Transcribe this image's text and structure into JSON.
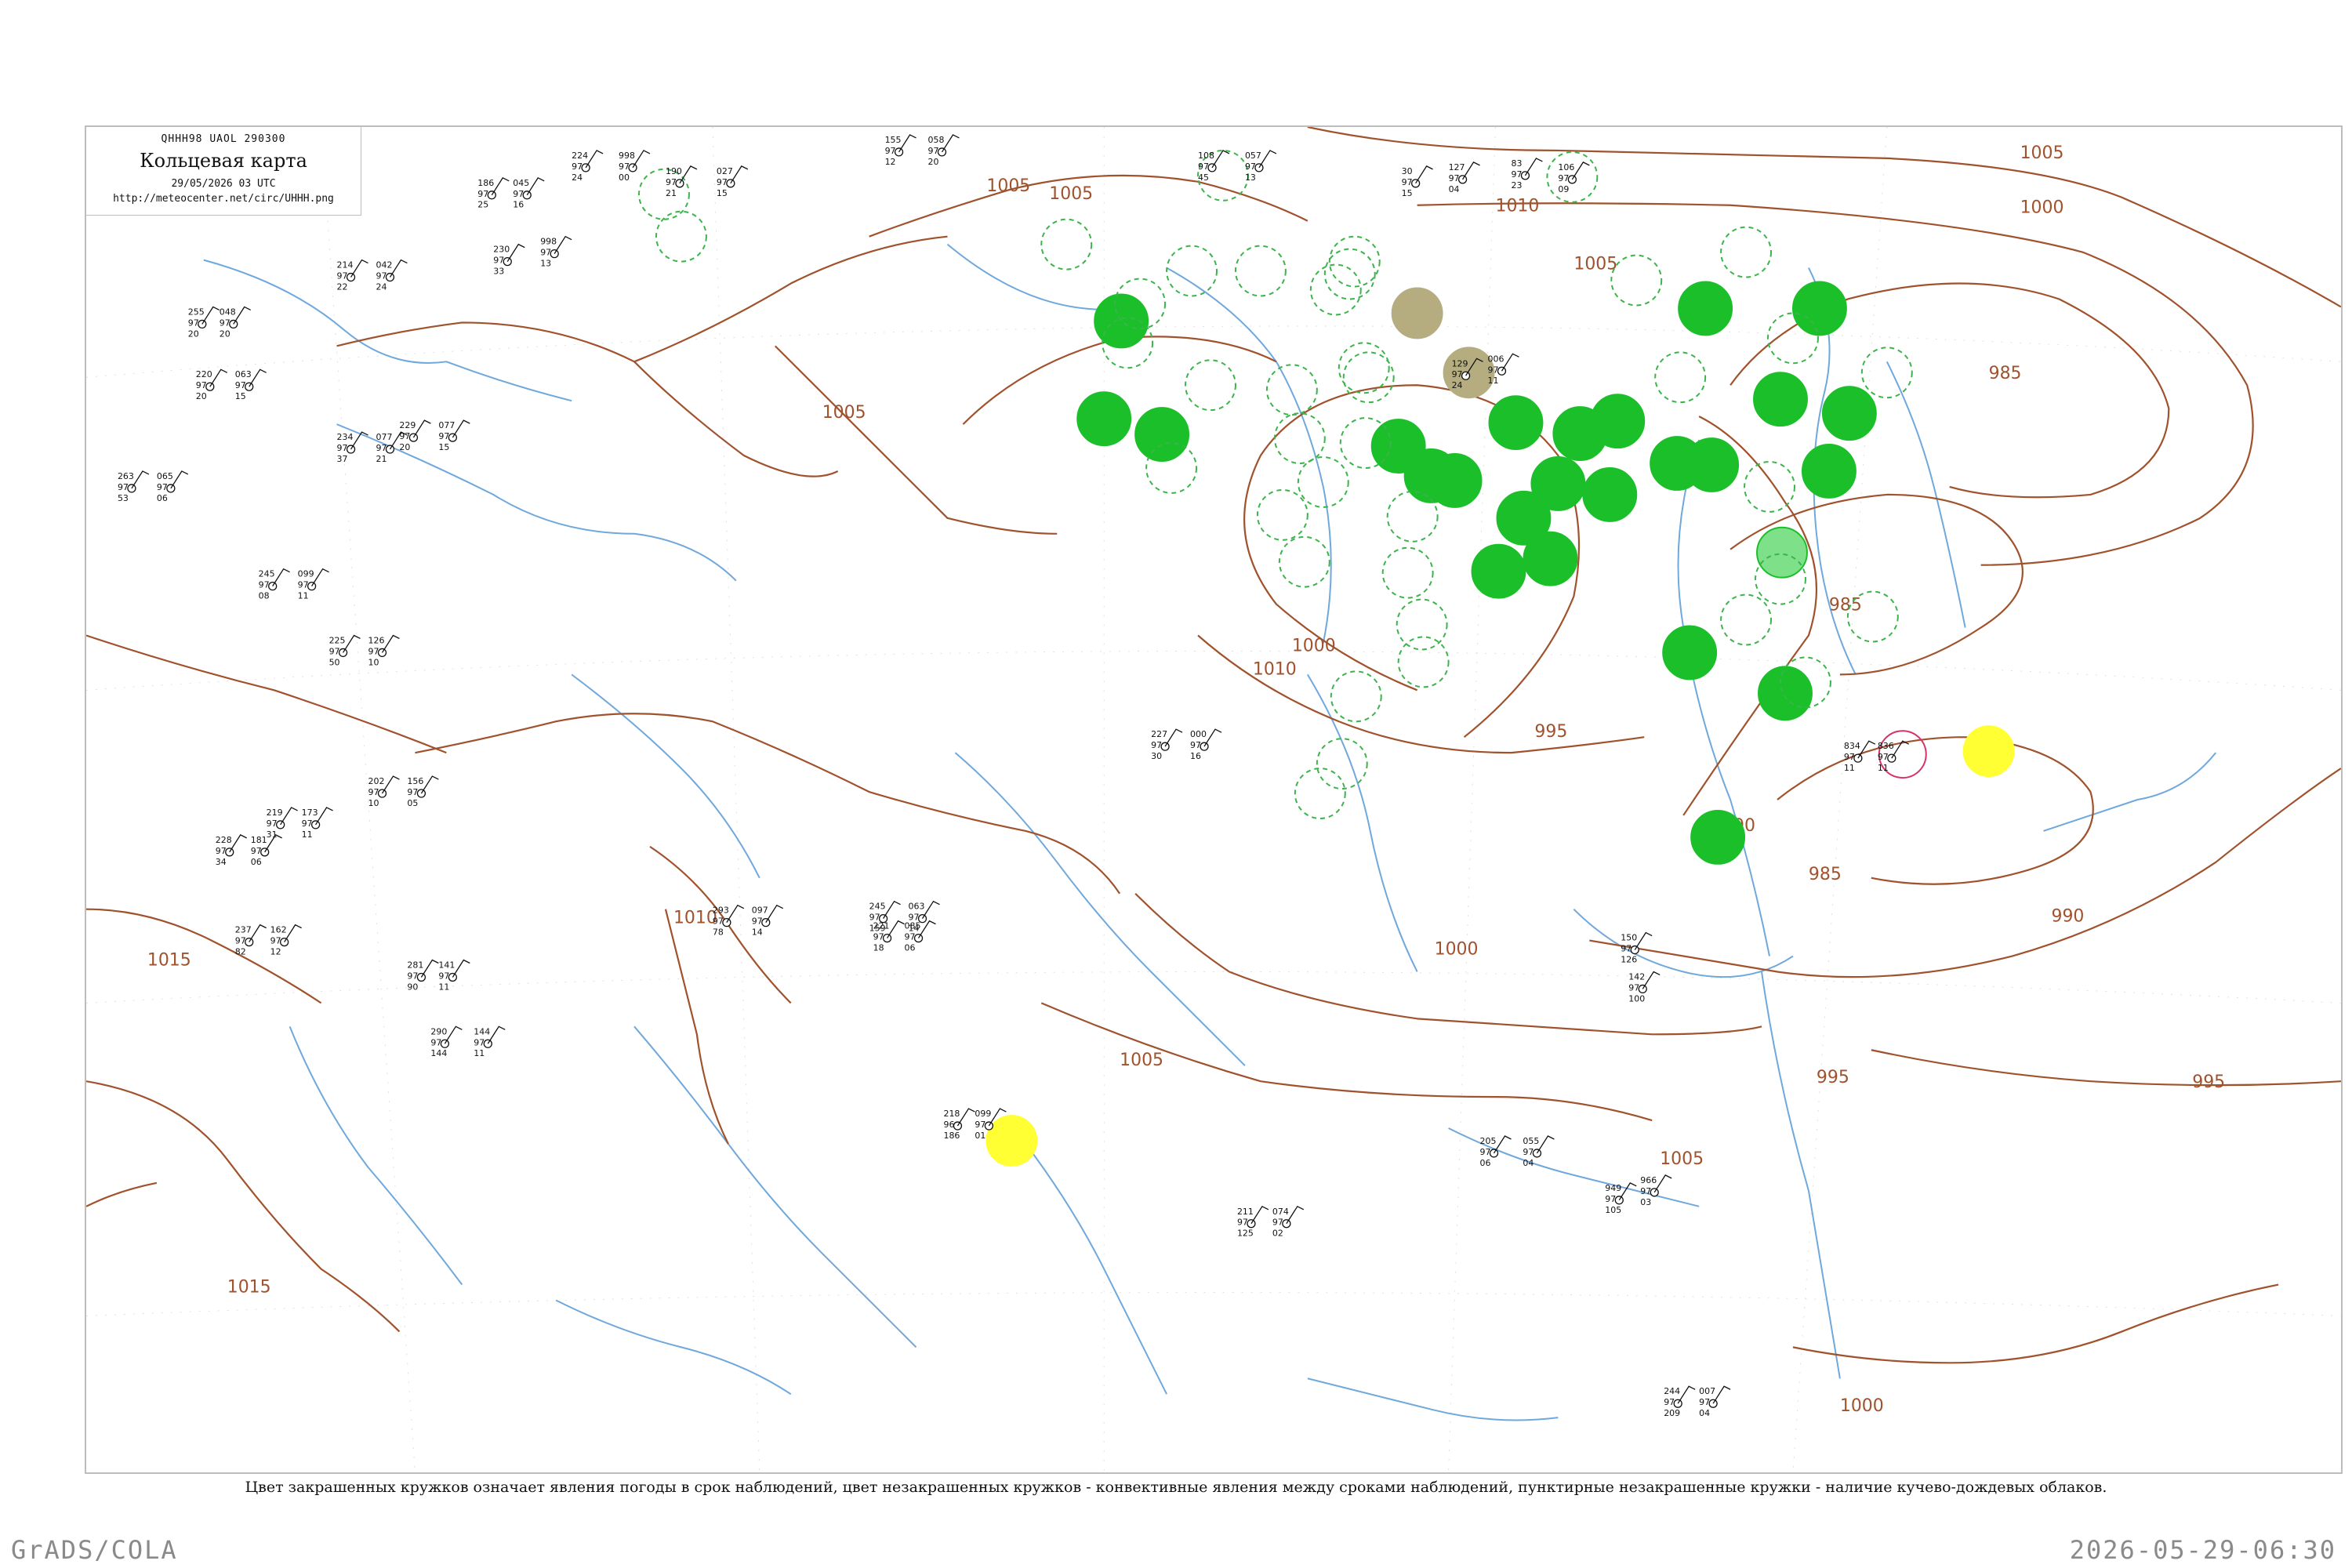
{
  "header": {
    "code": "QHHH98  UAOL  290300",
    "title": "Кольцевая карта",
    "datetime": "29/05/2026 03 UTC",
    "url": "http://meteocenter.net/circ/UHHH.png"
  },
  "caption": "Цвет закрашенных кружков означает явления погоды в срок наблюдений, цвет незакрашенных кружков - конвективные явления между сроками наблюдений, пунктирные незакрашенные кружки - наличие кучево-дождевых облаков.",
  "footer": {
    "left": "GrADS/COLA",
    "right": "2026-05-29-06:30"
  },
  "colors": {
    "isobar": "#a0522d",
    "river": "#6fa8dc",
    "rain_fill": "#1bbf2a",
    "rain_outline": "#1bbf2a",
    "shower_fill": "#7fe08a",
    "fog_fill": "#b5ad80",
    "haze_fill": "#ffff33",
    "thunder_outline": "#d6336c",
    "frame": "#bdbdbd",
    "footer": "#8a8a8a"
  },
  "isobar_labels": [
    "1005",
    "1005",
    "1005",
    "1005",
    "1010",
    "1010",
    "1005",
    "1000",
    "985",
    "985",
    "990",
    "995",
    "995",
    "1000",
    "1000",
    "1005",
    "1005",
    "1010",
    "1015",
    "1015",
    "995",
    "985",
    "990",
    "1000"
  ],
  "stations": [
    {
      "p": "224",
      "t": "97",
      "d": "24"
    },
    {
      "p": "998",
      "t": "97",
      "d": "00"
    },
    {
      "p": "190",
      "t": "97",
      "d": "21"
    },
    {
      "p": "027",
      "t": "97",
      "d": "15"
    },
    {
      "p": "155",
      "t": "97",
      "d": "12"
    },
    {
      "p": "058",
      "t": "97",
      "d": "20"
    },
    {
      "p": "108",
      "t": "97",
      "d": "45"
    },
    {
      "p": "057",
      "t": "97",
      "d": "13"
    },
    {
      "p": "230",
      "t": "97",
      "d": "33"
    },
    {
      "p": "998",
      "t": "97",
      "d": "13"
    },
    {
      "p": "186",
      "t": "97",
      "d": "25"
    },
    {
      "p": "045",
      "t": "97",
      "d": "16"
    },
    {
      "p": "30",
      "t": "97",
      "d": "15"
    },
    {
      "p": "127",
      "t": "97",
      "d": "04"
    },
    {
      "p": "83",
      "t": "97",
      "d": "23"
    },
    {
      "p": "106",
      "t": "97",
      "d": "09"
    },
    {
      "p": "214",
      "t": "97",
      "d": "22"
    },
    {
      "p": "042",
      "t": "97",
      "d": "24"
    },
    {
      "p": "255",
      "t": "97",
      "d": "20"
    },
    {
      "p": "048",
      "t": "97",
      "d": "20"
    },
    {
      "p": "220",
      "t": "97",
      "d": "20"
    },
    {
      "p": "063",
      "t": "97",
      "d": "15"
    },
    {
      "p": "263",
      "t": "97",
      "d": "53"
    },
    {
      "p": "065",
      "t": "97",
      "d": "06"
    },
    {
      "p": "234",
      "t": "97",
      "d": "37"
    },
    {
      "p": "077",
      "t": "97",
      "d": "21"
    },
    {
      "p": "229",
      "t": "97",
      "d": "20"
    },
    {
      "p": "077",
      "t": "97",
      "d": "15"
    },
    {
      "p": "245",
      "t": "97",
      "d": "08"
    },
    {
      "p": "099",
      "t": "97",
      "d": "11"
    },
    {
      "p": "225",
      "t": "97",
      "d": "50"
    },
    {
      "p": "126",
      "t": "97",
      "d": "10"
    },
    {
      "p": "202",
      "t": "97",
      "d": "10"
    },
    {
      "p": "156",
      "t": "97",
      "d": "05"
    },
    {
      "p": "219",
      "t": "97",
      "d": "31"
    },
    {
      "p": "173",
      "t": "97",
      "d": "11"
    },
    {
      "p": "228",
      "t": "97",
      "d": "34"
    },
    {
      "p": "181",
      "t": "97",
      "d": "06"
    },
    {
      "p": "237",
      "t": "97",
      "d": "82"
    },
    {
      "p": "162",
      "t": "97",
      "d": "12"
    },
    {
      "p": "281",
      "t": "97",
      "d": "90"
    },
    {
      "p": "141",
      "t": "97",
      "d": "11"
    },
    {
      "p": "290",
      "t": "97",
      "d": "144"
    },
    {
      "p": "144",
      "t": "97",
      "d": "11"
    },
    {
      "p": "293",
      "t": "97",
      "d": "78"
    },
    {
      "p": "097",
      "t": "97",
      "d": "14"
    },
    {
      "p": "245",
      "t": "97",
      "d": "159"
    },
    {
      "p": "063",
      "t": "97",
      "d": "14"
    },
    {
      "p": "221",
      "t": "97",
      "d": "18"
    },
    {
      "p": "085",
      "t": "97",
      "d": "06"
    },
    {
      "p": "227",
      "t": "97",
      "d": "30"
    },
    {
      "p": "000",
      "t": "97",
      "d": "16"
    },
    {
      "p": "218",
      "t": "96",
      "d": "186"
    },
    {
      "p": "099",
      "t": "97",
      "d": "01"
    },
    {
      "p": "205",
      "t": "97",
      "d": "06"
    },
    {
      "p": "055",
      "t": "97",
      "d": "04"
    },
    {
      "p": "211",
      "t": "97",
      "d": "125"
    },
    {
      "p": "074",
      "t": "97",
      "d": "02"
    },
    {
      "p": "244",
      "t": "97",
      "d": "209"
    },
    {
      "p": "007",
      "t": "97",
      "d": "04"
    },
    {
      "p": "129",
      "t": "97",
      "d": "24"
    },
    {
      "p": "006",
      "t": "97",
      "d": "11"
    },
    {
      "p": "834",
      "t": "97",
      "d": "11"
    },
    {
      "p": "836",
      "t": "97",
      "d": "11"
    },
    {
      "p": "150",
      "t": "97",
      "d": "126"
    },
    {
      "p": "142",
      "t": "97",
      "d": "100"
    },
    {
      "p": "949",
      "t": "97",
      "d": "105"
    },
    {
      "p": "966",
      "t": "97",
      "d": "03"
    }
  ]
}
